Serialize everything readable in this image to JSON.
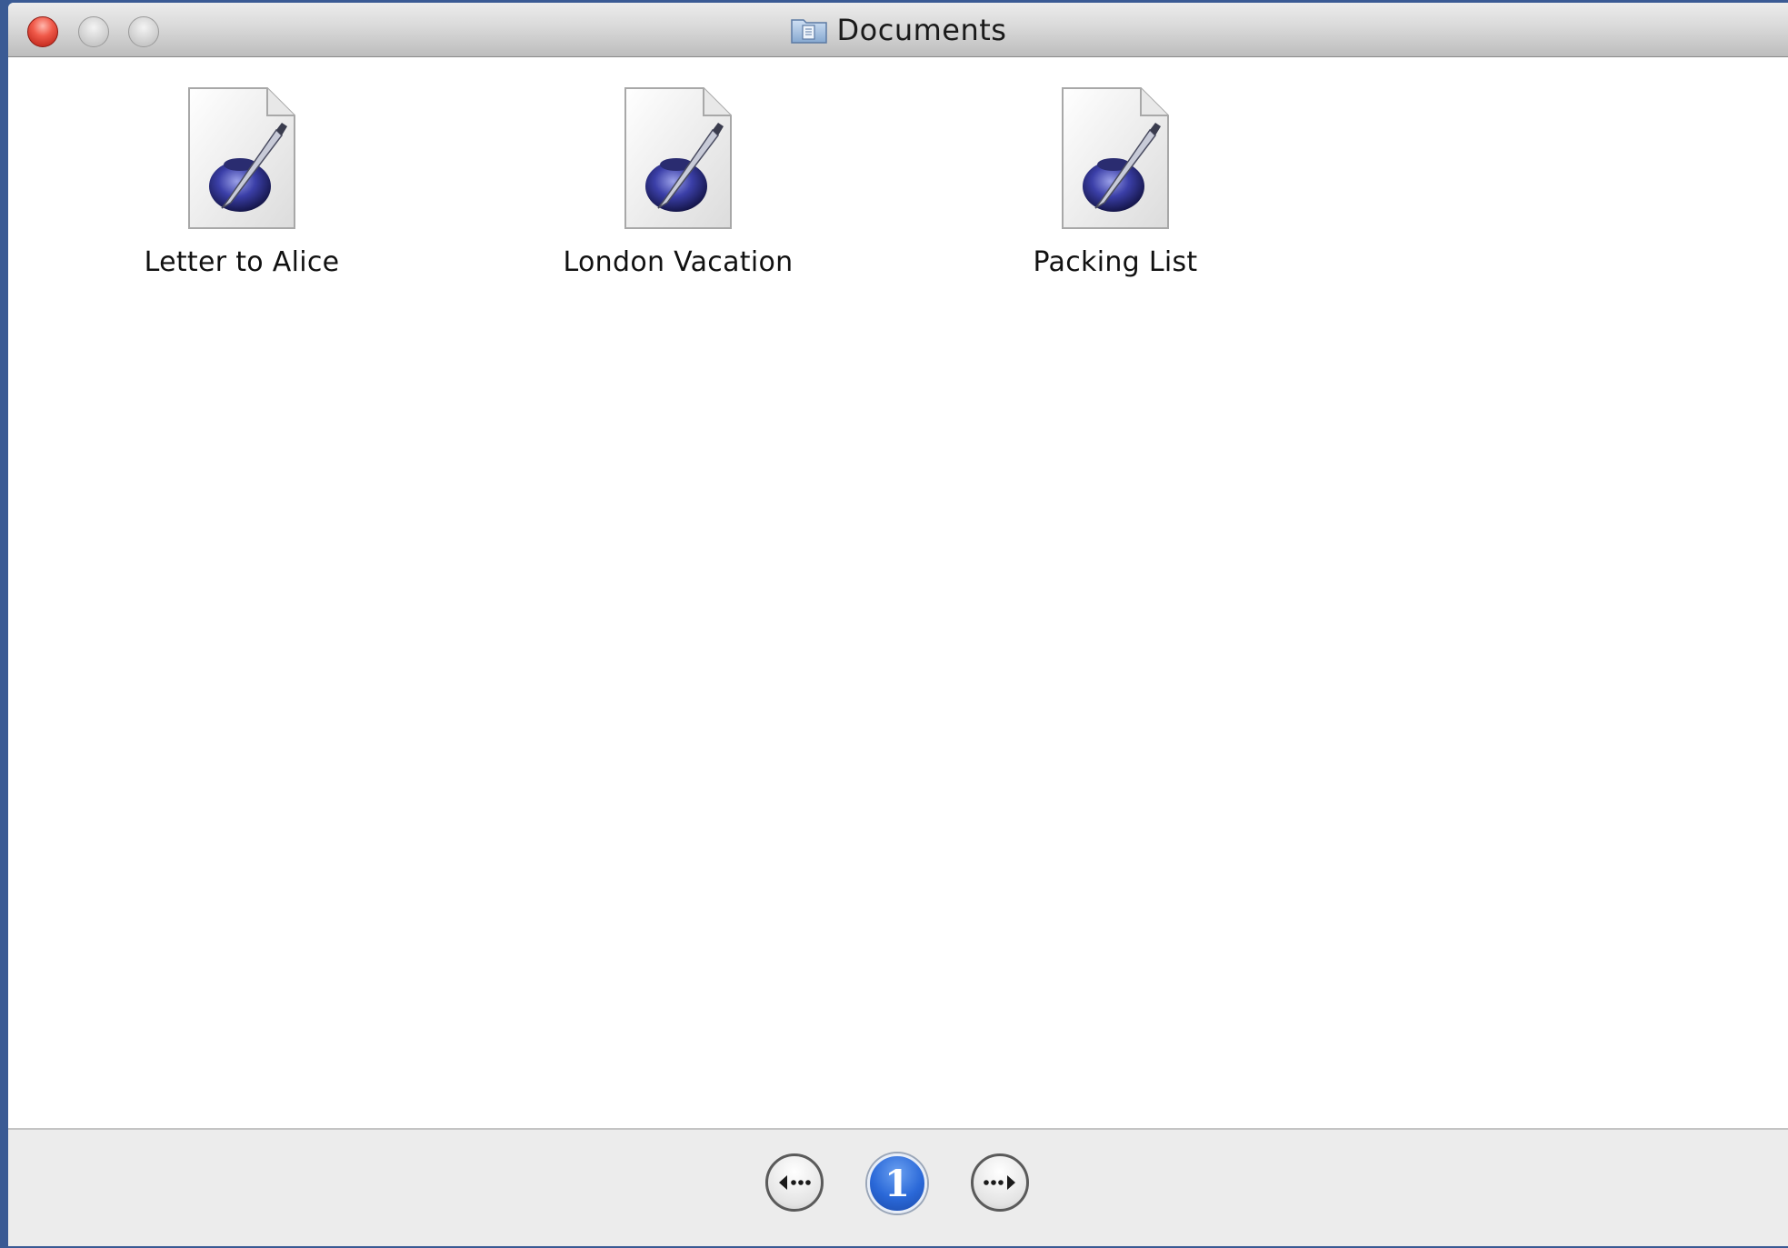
{
  "window": {
    "title": "Documents",
    "title_icon": "folder-icon",
    "controls": [
      "close",
      "minimize",
      "zoom"
    ]
  },
  "files": [
    {
      "name": "Letter to Alice",
      "icon": "document-ink-pen-icon"
    },
    {
      "name": "London Vacation",
      "icon": "document-ink-pen-icon"
    },
    {
      "name": "Packing List",
      "icon": "document-ink-pen-icon"
    }
  ],
  "pager": {
    "prev_icon": "arrow-left-icon",
    "current_page": "1",
    "next_icon": "arrow-right-icon"
  },
  "colors": {
    "desktop": "#3a5a94",
    "close_button": "#e0443a",
    "page_badge": "#2a68d8"
  }
}
